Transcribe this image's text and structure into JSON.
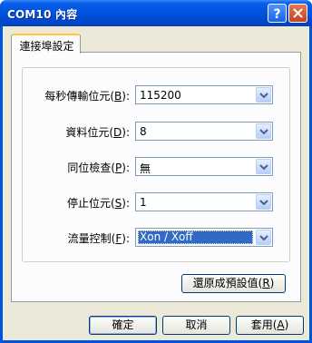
{
  "window": {
    "title": "COM10 內容"
  },
  "tabs": [
    {
      "label": "連接埠設定"
    }
  ],
  "settings": [
    {
      "label": "每秒傳輸位元",
      "accel": "B",
      "value": "115200"
    },
    {
      "label": "資料位元",
      "accel": "D",
      "value": "8"
    },
    {
      "label": "同位檢查",
      "accel": "P",
      "value": "無"
    },
    {
      "label": "停止位元",
      "accel": "S",
      "value": "1"
    },
    {
      "label": "流量控制",
      "accel": "F",
      "value": "Xon / Xoff",
      "focused": true
    }
  ],
  "restore_button": {
    "label": "還原成預設值",
    "accel": "R"
  },
  "footer": {
    "ok_label": "確定",
    "cancel_label": "取消",
    "apply_label": "套用",
    "apply_accel": "A"
  },
  "colors": {
    "title_bar": "#0054e3",
    "selection": "#316ac5",
    "dialog_bg": "#ece9d8",
    "tab_highlight": "#ffc83c"
  },
  "icons": {
    "help": "question-mark-icon",
    "close": "close-x-icon",
    "dropdown": "chevron-down-icon"
  }
}
